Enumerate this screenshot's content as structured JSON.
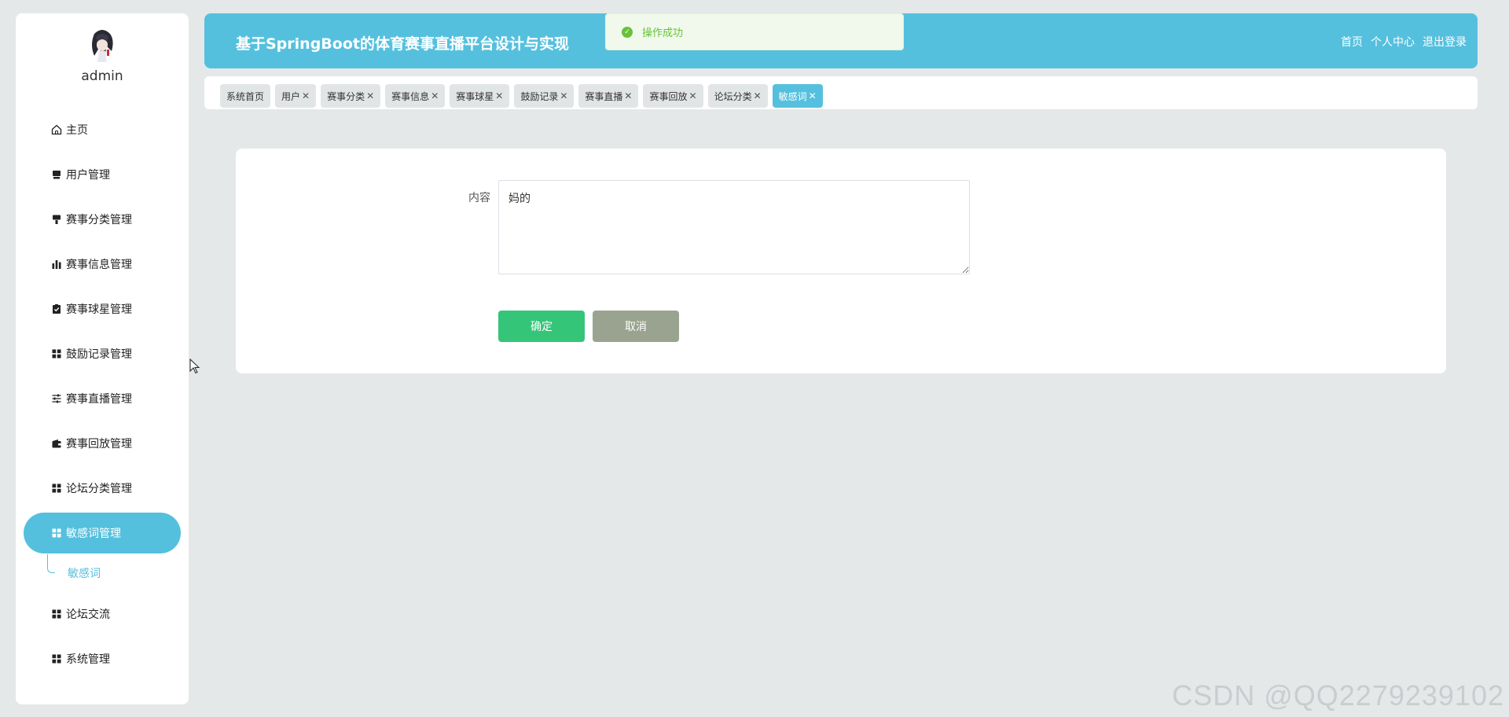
{
  "sidebar": {
    "username": "admin",
    "items": [
      {
        "label": "主页",
        "icon": "home-icon"
      },
      {
        "label": "用户管理",
        "icon": "monitor-icon"
      },
      {
        "label": "赛事分类管理",
        "icon": "brush-icon"
      },
      {
        "label": "赛事信息管理",
        "icon": "bar-chart-icon"
      },
      {
        "label": "赛事球星管理",
        "icon": "clipboard-check-icon"
      },
      {
        "label": "鼓励记录管理",
        "icon": "grid-icon"
      },
      {
        "label": "赛事直播管理",
        "icon": "sliders-icon"
      },
      {
        "label": "赛事回放管理",
        "icon": "wallet-icon"
      },
      {
        "label": "论坛分类管理",
        "icon": "grid-icon"
      },
      {
        "label": "敏感词管理",
        "icon": "grid-icon",
        "active": true
      },
      {
        "label": "论坛交流",
        "icon": "grid-icon"
      },
      {
        "label": "系统管理",
        "icon": "grid-icon"
      }
    ],
    "submenu": {
      "label": "敏感词"
    }
  },
  "header": {
    "title": "基于SpringBoot的体育赛事直播平台设计与实现",
    "links": [
      "首页",
      "个人中心",
      "退出登录"
    ]
  },
  "toast": {
    "text": "操作成功",
    "color": "#67c23a"
  },
  "tabs": [
    {
      "label": "系统首页",
      "closable": false
    },
    {
      "label": "用户",
      "closable": true
    },
    {
      "label": "赛事分类",
      "closable": true
    },
    {
      "label": "赛事信息",
      "closable": true
    },
    {
      "label": "赛事球星",
      "closable": true
    },
    {
      "label": "鼓励记录",
      "closable": true
    },
    {
      "label": "赛事直播",
      "closable": true
    },
    {
      "label": "赛事回放",
      "closable": true
    },
    {
      "label": "论坛分类",
      "closable": true
    },
    {
      "label": "敏感词",
      "closable": true,
      "active": true
    }
  ],
  "form": {
    "content_label": "内容",
    "content_value": "妈的",
    "confirm_label": "确定",
    "cancel_label": "取消"
  },
  "watermark": "CSDN @QQ2279239102",
  "colors": {
    "accent": "#55c0de",
    "confirm": "#35c579",
    "cancel": "#9aa38f",
    "background": "#e4e8e9"
  }
}
